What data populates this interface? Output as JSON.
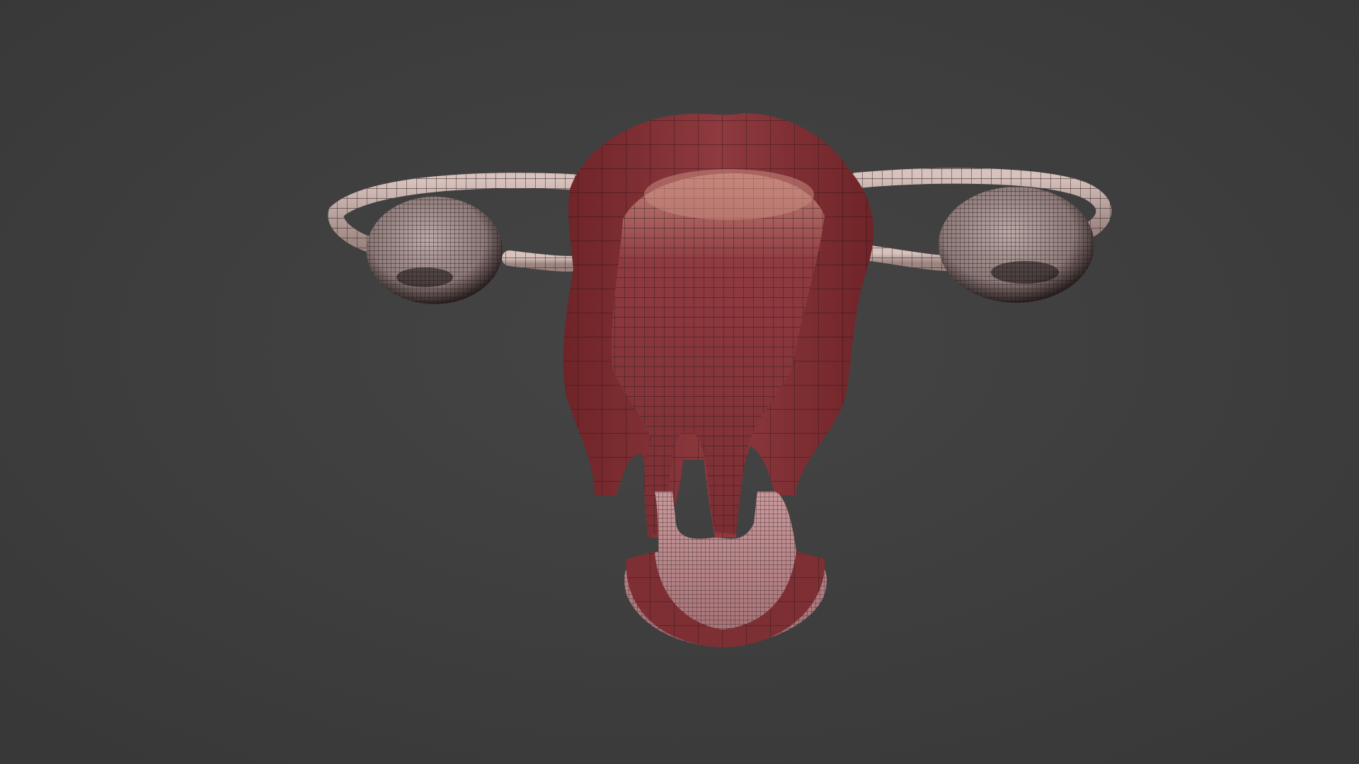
{
  "viewport": {
    "background_color": "#3d3d3d"
  },
  "colors": {
    "uterus_wall": "#7e2f34",
    "uterus_wall_highlight": "#a04a4f",
    "cavity": "#8a3a40",
    "cavity_highlight": "#b56a6a",
    "adnexa_tissue": "#cbb2ae",
    "mesh_wire": "#1a1010"
  }
}
